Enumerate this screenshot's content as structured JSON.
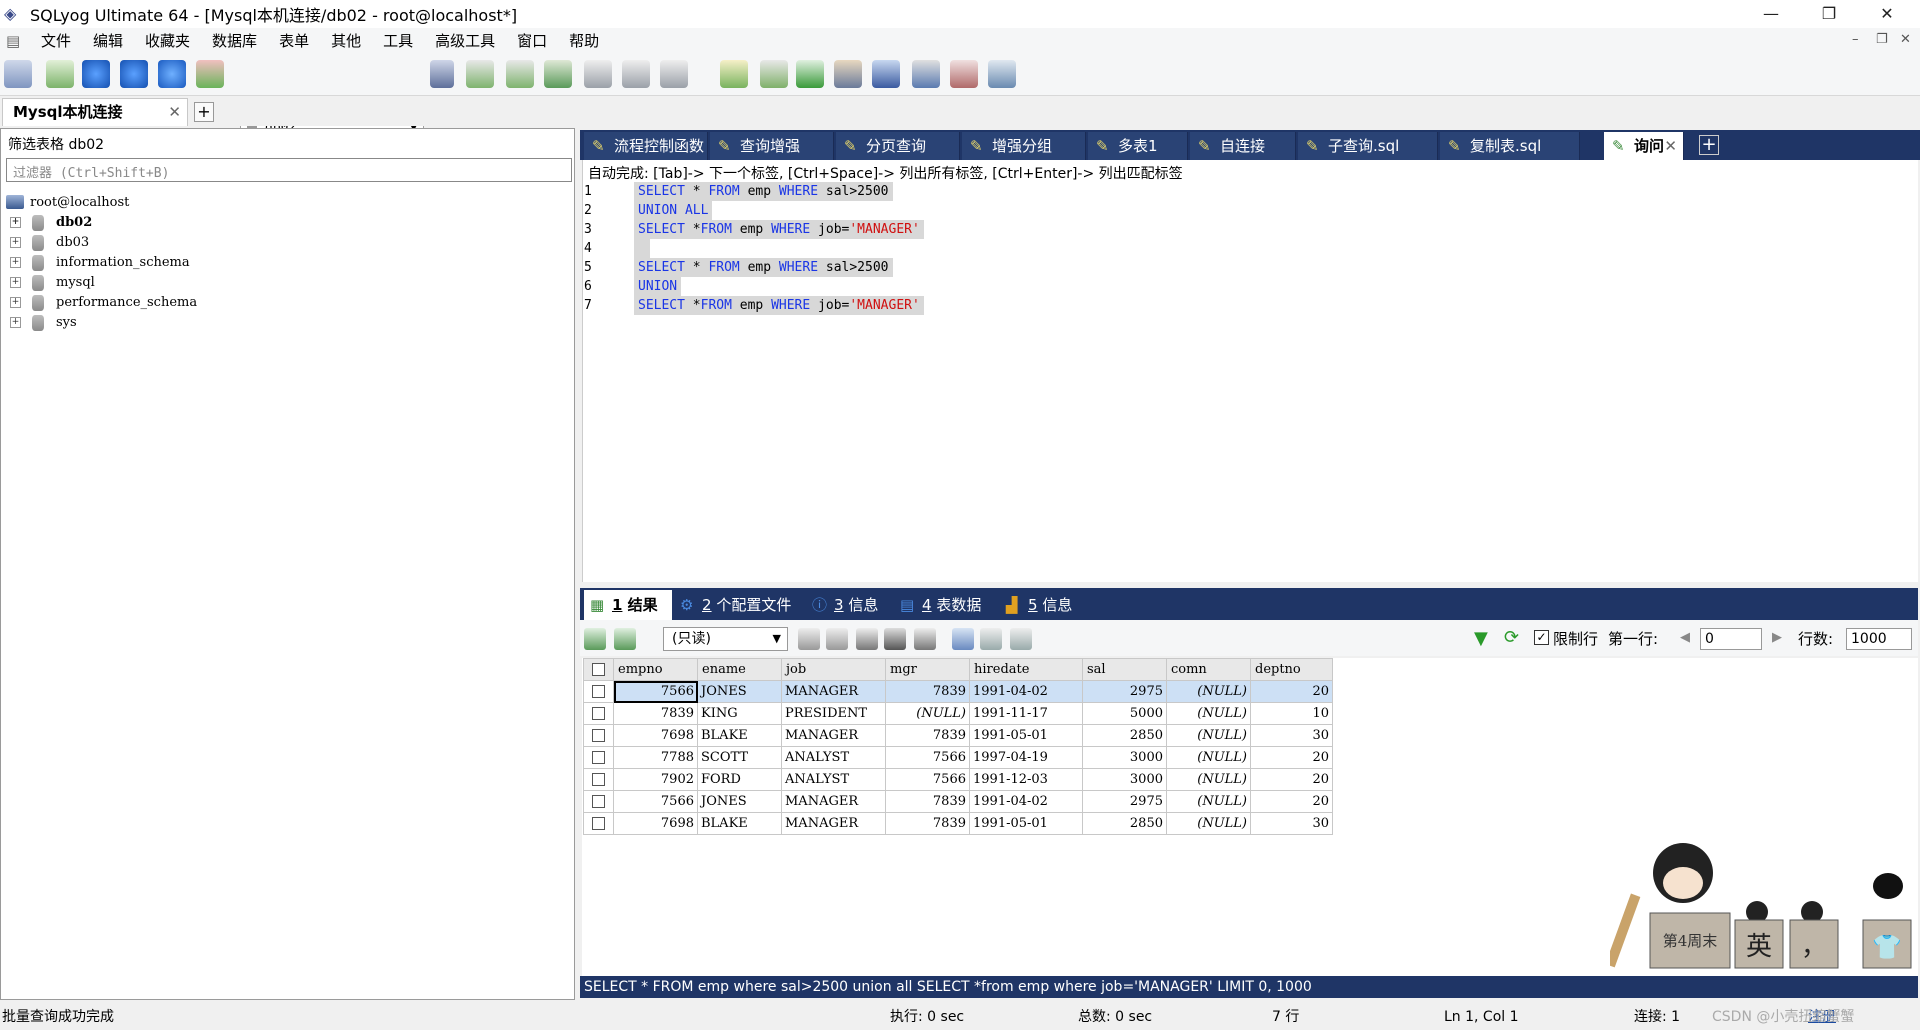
{
  "window": {
    "title": "SQLyog Ultimate 64 - [Mysql本机连接/db02 - root@localhost*]"
  },
  "menu": [
    "文件",
    "编辑",
    "收藏夹",
    "数据库",
    "表单",
    "其他",
    "工具",
    "高级工具",
    "窗口",
    "帮助"
  ],
  "toolbar": {
    "db_selector": "db02"
  },
  "connection_tab": {
    "label": "Mysql本机连接"
  },
  "object_browser": {
    "filter_label": "筛选表格  db02",
    "filter_placeholder": "过滤器 (Ctrl+Shift+B)",
    "root": "root@localhost",
    "databases": [
      "db02",
      "db03",
      "information_schema",
      "mysql",
      "performance_schema",
      "sys"
    ]
  },
  "query_tabs": [
    "流程控制函数",
    "查询增强",
    "分页查询",
    "增强分组",
    "多表1",
    "自连接",
    "子查询.sql",
    "复制表.sql",
    "询问"
  ],
  "editor": {
    "autocomplete_hint": "自动完成: [Tab]-> 下一个标签, [Ctrl+Space]-> 列出所有标签, [Ctrl+Enter]-> 列出匹配标签",
    "line_numbers": [
      "1",
      "2",
      "3",
      "4",
      "5",
      "6",
      "7"
    ]
  },
  "result_tabs": [
    {
      "num": "1",
      "label": "结果"
    },
    {
      "num": "2",
      "label": "个配置文件"
    },
    {
      "num": "3",
      "label": "信息"
    },
    {
      "num": "4",
      "label": "表数据"
    },
    {
      "num": "5",
      "label": "信息"
    }
  ],
  "result_toolbar": {
    "mode": "(只读)",
    "limit_label": "限制行",
    "first_row_label": "第一行:",
    "first_row_value": "0",
    "rows_label": "行数:",
    "rows_value": "1000"
  },
  "grid": {
    "columns": [
      "empno",
      "ename",
      "job",
      "mgr",
      "hiredate",
      "sal",
      "comn",
      "deptno"
    ],
    "rows": [
      [
        "7566",
        "JONES",
        "MANAGER",
        "7839",
        "1991-04-02",
        "2975",
        "(NULL)",
        "20"
      ],
      [
        "7839",
        "KING",
        "PRESIDENT",
        "(NULL)",
        "1991-11-17",
        "5000",
        "(NULL)",
        "10"
      ],
      [
        "7698",
        "BLAKE",
        "MANAGER",
        "7839",
        "1991-05-01",
        "2850",
        "(NULL)",
        "30"
      ],
      [
        "7788",
        "SCOTT",
        "ANALYST",
        "7566",
        "1997-04-19",
        "3000",
        "(NULL)",
        "20"
      ],
      [
        "7902",
        "FORD",
        "ANALYST",
        "7566",
        "1991-12-03",
        "3000",
        "(NULL)",
        "20"
      ],
      [
        "7566",
        "JONES",
        "MANAGER",
        "7839",
        "1991-04-02",
        "2975",
        "(NULL)",
        "20"
      ],
      [
        "7698",
        "BLAKE",
        "MANAGER",
        "7839",
        "1991-05-01",
        "2850",
        "(NULL)",
        "30"
      ]
    ]
  },
  "sql_status": "SELECT * FROM emp where sal>2500 union all SELECT *from emp where job='MANAGER' LIMIT 0, 1000",
  "status": {
    "message": "批量查询成功完成",
    "exec": "执行: 0 sec",
    "total": "总数: 0 sec",
    "rows": "7 行",
    "position": "Ln 1, Col 1",
    "connections": "连接: 1",
    "register": "注册",
    "watermark": "CSDN @小壳扭缩蟹蟹"
  },
  "mascot": {
    "sign": "第4周末",
    "keys": [
      "英",
      "，",
      "👕"
    ]
  },
  "colors": {
    "accent": "#1f3566",
    "keyword": "#1a35e6",
    "string": "#d01010"
  }
}
